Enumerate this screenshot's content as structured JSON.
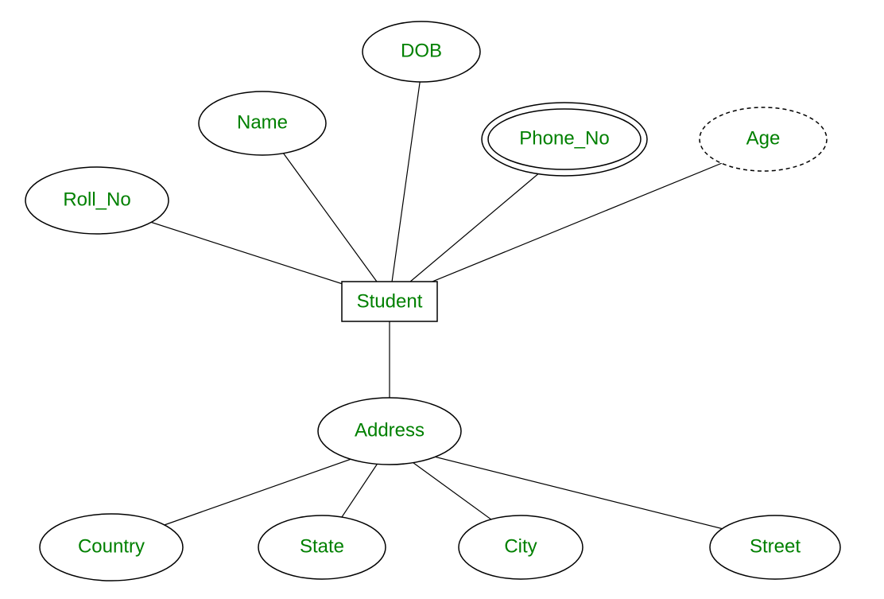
{
  "diagram": {
    "entity": "Student",
    "attributes": {
      "dob": "DOB",
      "name": "Name",
      "roll_no": "Roll_No",
      "phone_no": "Phone_No",
      "age": "Age",
      "address": "Address"
    },
    "address_parts": {
      "country": "Country",
      "state": "State",
      "city": "City",
      "street": "Street"
    }
  }
}
